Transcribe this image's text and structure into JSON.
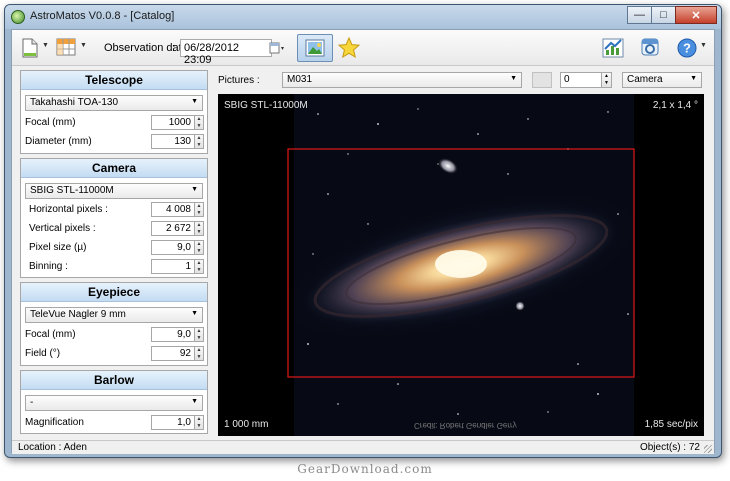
{
  "window": {
    "title": "AstroMatos V0.0.8 - [Catalog]"
  },
  "toolbar": {
    "observation_label": "Observation date",
    "observation_value": "06/28/2012 23:09"
  },
  "telescope": {
    "heading": "Telescope",
    "model": "Takahashi TOA-130",
    "focal_label": "Focal (mm)",
    "focal_value": "1000",
    "diameter_label": "Diameter (mm)",
    "diameter_value": "130"
  },
  "camera": {
    "heading": "Camera",
    "model": "SBIG STL-11000M",
    "hpix_label": "Horizontal pixels :",
    "hpix_value": "4 008",
    "vpix_label": "Vertical pixels :",
    "vpix_value": "2 672",
    "pixsize_label": "Pixel size (µ)",
    "pixsize_value": "9,0",
    "binning_label": "Binning :",
    "binning_value": "1"
  },
  "eyepiece": {
    "heading": "Eyepiece",
    "model": "TeleVue Nagler 9 mm",
    "focal_label": "Focal (mm)",
    "focal_value": "9,0",
    "field_label": "Field (°)",
    "field_value": "92"
  },
  "barlow": {
    "heading": "Barlow",
    "model": "-",
    "mag_label": "Magnification",
    "mag_value": "1,0"
  },
  "pictures": {
    "label": "Pictures :",
    "selected": "M031",
    "rotation": "0",
    "view_mode": "Camera"
  },
  "viewer": {
    "camera_name": "SBIG STL-11000M",
    "field_size": "2,1 x 1,4 °",
    "focal_length": "1 000 mm",
    "scale": "1,85 sec/pix",
    "credit": "Credit: Robert Gendler Gerry"
  },
  "status": {
    "location": "Location : Aden",
    "objects": "Object(s) : 72"
  },
  "watermark": "GearDownload.com"
}
